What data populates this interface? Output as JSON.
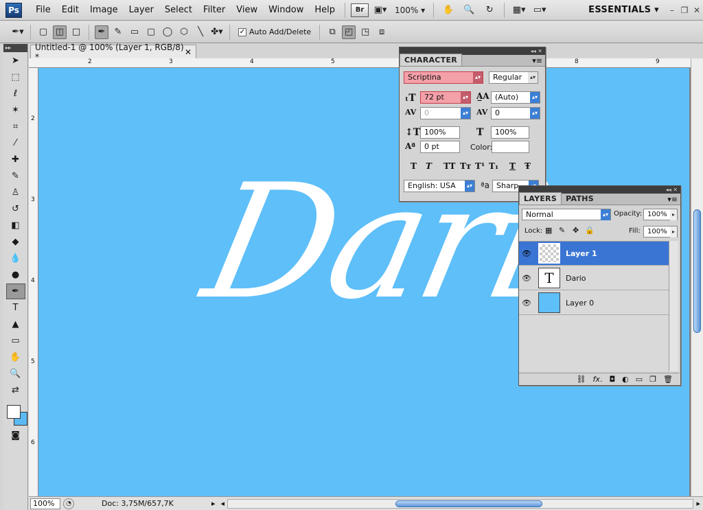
{
  "menubar": {
    "logo": "Ps",
    "items": [
      "File",
      "Edit",
      "Image",
      "Layer",
      "Select",
      "Filter",
      "View",
      "Window",
      "Help"
    ],
    "bridge": "Br",
    "zoom": "100%",
    "workspace": "ESSENTIALS"
  },
  "options": {
    "auto_add_delete_label": "Auto Add/Delete"
  },
  "document": {
    "tab_title": "Untitled-1 @ 100% (Layer 1, RGB/8) *",
    "canvas_text": "Dario",
    "canvas_color": "#5ebff9",
    "ruler_top_numbers": [
      "2",
      "3",
      "4",
      "5",
      "8",
      "9"
    ],
    "ruler_left_numbers": [
      "2",
      "3",
      "4",
      "5",
      "6"
    ]
  },
  "status": {
    "zoom": "100%",
    "doc_info": "Doc: 3,75M/657,7K"
  },
  "character": {
    "title": "CHARACTER",
    "font_family": "Scriptina",
    "font_style": "Regular",
    "font_size": "72 pt",
    "leading": "(Auto)",
    "kerning": "0",
    "tracking": "0",
    "vertical_scale": "100%",
    "horizontal_scale": "100%",
    "baseline_shift": "0 pt",
    "color_label": "Color:",
    "language": "English: USA",
    "aa_label": "a",
    "antialias": "Sharp",
    "styles": [
      "T",
      "T",
      "TT",
      "Tт",
      "T¹",
      "T₁",
      "T",
      "Ŧ"
    ]
  },
  "layers": {
    "tabs": [
      "LAYERS",
      "PATHS"
    ],
    "blend_mode": "Normal",
    "opacity_label": "Opacity:",
    "opacity": "100%",
    "lock_label": "Lock:",
    "fill_label": "Fill:",
    "fill": "100%",
    "items": [
      {
        "name": "Layer 1"
      },
      {
        "name": "Dario",
        "thumb_glyph": "T"
      },
      {
        "name": "Layer 0"
      }
    ],
    "footer_icons": [
      "link-icon",
      "fx-icon",
      "mask-icon",
      "adjustment-icon",
      "group-folder-icon",
      "new-layer-icon",
      "trash-icon"
    ]
  }
}
